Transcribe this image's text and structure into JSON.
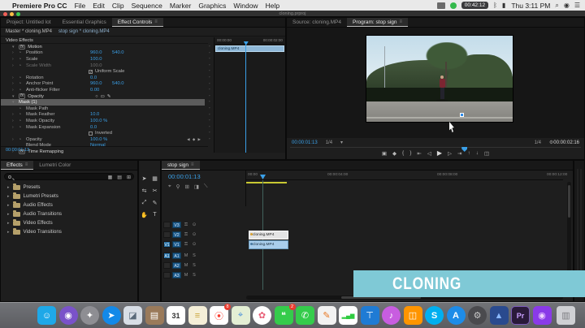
{
  "colors": {
    "accent_blue": "#3aa0e8",
    "value_blue": "#3aa0e8",
    "banner_teal": "#7fc9d6",
    "clip_blue": "#a9cdeb",
    "clip_selected": "#e4e4e4",
    "render_bar_yellow": "#c8c832",
    "menubar_bg": "#e9e9e9",
    "panel_bg": "#1e1e1e"
  },
  "menubar": {
    "app_name": "Premiere Pro CC",
    "menus": [
      "File",
      "Edit",
      "Clip",
      "Sequence",
      "Marker",
      "Graphics",
      "Window",
      "Help"
    ],
    "timer_badge": "00:42:12",
    "clock": "Thu 3:11 PM"
  },
  "window_title": "cloning.prproj",
  "effect_controls": {
    "tabs": [
      {
        "label": "Project: Untitled lot"
      },
      {
        "label": "Essential Graphics"
      },
      {
        "label": "Effect Controls"
      }
    ],
    "breadcrumb": {
      "master": "Master * cloning.MP4",
      "clip": "stop sign * cloning.MP4"
    },
    "section_video_effects": "Video Effects",
    "rows": [
      {
        "label": "Motion"
      },
      {
        "label": "Position",
        "value": "960.0",
        "value2": "540.0"
      },
      {
        "label": "Scale",
        "value": "100.0"
      },
      {
        "label": "Scale Width",
        "value": "100.0"
      },
      {
        "label": "Uniform Scale",
        "check": "✓"
      },
      {
        "label": "Rotation",
        "value": "0.0"
      },
      {
        "label": "Anchor Point",
        "value": "960.0",
        "value2": "540.0"
      },
      {
        "label": "Anti-flicker Filter",
        "value": "0.00"
      },
      {
        "label": "Opacity"
      },
      {
        "label": "Mask (1)"
      },
      {
        "label": "Mask Path"
      },
      {
        "label": "Mask Feather",
        "value": "10.0"
      },
      {
        "label": "Mask Opacity",
        "value": "100.0 %"
      },
      {
        "label": "Mask Expansion",
        "value": "0.0"
      },
      {
        "label": "Inverted",
        "check": ""
      },
      {
        "label": "Opacity",
        "value": "100.0 %"
      },
      {
        "label": "Blend Mode",
        "value": "Normal"
      },
      {
        "label": "Time Remapping"
      }
    ],
    "timecode": "00:00:01:13",
    "mini_timeline": {
      "tick_left": "00:00:00",
      "tick_right": "00:00:02:00",
      "clip_label": "cloning.MP4"
    }
  },
  "program": {
    "tabs": [
      {
        "label": "Source: cloning.MP4"
      },
      {
        "label": "Program: stop sign"
      }
    ],
    "tc_current": "00:00:01:13",
    "zoom_level": "1/4",
    "playback_res": "1/4",
    "tc_duration": "00:00:02:16",
    "transport": [
      "▣",
      "◆",
      "{",
      "}",
      "⇤",
      "◁",
      "▶",
      "▷",
      "⇥",
      "↑",
      "↓",
      "◫"
    ]
  },
  "effects_panel": {
    "tabs": [
      {
        "label": "Effects"
      },
      {
        "label": "Lumetri Color"
      }
    ],
    "bin_icons": [
      "▦",
      "▤",
      "⊞"
    ],
    "folders": [
      "Presets",
      "Lumetri Presets",
      "Audio Effects",
      "Audio Transitions",
      "Video Effects",
      "Video Transitions"
    ]
  },
  "tools": [
    {
      "name": "selection-tool",
      "glyph": "➤"
    },
    {
      "name": "track-select-tool",
      "glyph": "▦"
    },
    {
      "name": "ripple-edit-tool",
      "glyph": "⇆"
    },
    {
      "name": "razor-tool",
      "glyph": "✂"
    },
    {
      "name": "slip-tool",
      "glyph": "⤢"
    },
    {
      "name": "pen-tool",
      "glyph": "✎"
    },
    {
      "name": "hand-tool",
      "glyph": "✋"
    },
    {
      "name": "type-tool",
      "glyph": "T"
    }
  ],
  "timeline": {
    "tab": "stop sign",
    "timecode": "00:00:01:13",
    "toolbar_icons": [
      "⌖",
      "⚲",
      "⊞",
      "◨",
      "⟍"
    ],
    "ruler_ticks": [
      "00:00",
      "00:00:04:00",
      "00:00:08:00",
      "00:00:12:00"
    ],
    "video_tracks": [
      "V3",
      "V2",
      "V1"
    ],
    "audio_tracks": [
      "A1",
      "A2",
      "A3"
    ],
    "clip_top": "cloning.MP4",
    "clip_bottom": "cloning.MP4"
  },
  "banner": {
    "text": "CLONING"
  },
  "dock": {
    "items": [
      {
        "name": "finder",
        "glyph": "☺",
        "bg": "#1ea8e8"
      },
      {
        "name": "siri",
        "glyph": "◉",
        "bg": "#7a52c9",
        "round": true
      },
      {
        "name": "launchpad",
        "glyph": "✦",
        "bg": "#8e8e93",
        "round": true
      },
      {
        "name": "safari",
        "glyph": "➤",
        "bg": "#1389e8",
        "round": true
      },
      {
        "name": "preview",
        "glyph": "◪",
        "bg": "#d8dee6",
        "fg": "#5a6a7a"
      },
      {
        "name": "contacts",
        "glyph": "▤",
        "bg": "#9a7a5a"
      },
      {
        "name": "calendar",
        "glyph": "31",
        "bg": "#ffffff",
        "fg": "#333333"
      },
      {
        "name": "notes",
        "glyph": "≡",
        "bg": "#f5efd8",
        "fg": "#caa53d"
      },
      {
        "name": "reminders",
        "glyph": "⦿",
        "bg": "#ffffff",
        "fg": "#fa3b30",
        "badge": "8"
      },
      {
        "name": "maps",
        "glyph": "⌖",
        "bg": "#e4efd4",
        "fg": "#4a90d9"
      },
      {
        "name": "photos",
        "glyph": "✿",
        "bg": "#ffffff",
        "fg": "#e85d75",
        "round": true
      },
      {
        "name": "messages",
        "glyph": "❝",
        "bg": "#35cc4b",
        "badge": "2"
      },
      {
        "name": "facetime",
        "glyph": "✆",
        "bg": "#35cc4b"
      },
      {
        "name": "pages",
        "glyph": "✎",
        "bg": "#f2f2f2",
        "fg": "#e87722"
      },
      {
        "name": "stocks",
        "glyph": "▂▄▆",
        "bg": "#ffffff",
        "fg": "#2ecc40"
      },
      {
        "name": "keynote",
        "glyph": "⊤",
        "bg": "#1f7bd4"
      },
      {
        "name": "music",
        "glyph": "♪",
        "bg": "#c85de0",
        "round": true
      },
      {
        "name": "books",
        "glyph": "◫",
        "bg": "#ff9500"
      },
      {
        "name": "skype",
        "glyph": "S",
        "bg": "#00aff0",
        "round": true
      },
      {
        "name": "app-store",
        "glyph": "A",
        "bg": "#1e8ce8",
        "round": true
      },
      {
        "name": "system-preferences",
        "glyph": "⚙",
        "bg": "#4a4a4e",
        "fg": "#c8c8c8",
        "round": true
      },
      {
        "name": "blue-peaks-app",
        "glyph": "▲",
        "bg": "#2a4a8e",
        "fg": "#8ab8ff"
      },
      {
        "name": "premiere-pro",
        "glyph": "Pr",
        "bg": "#2a1a3a",
        "fg": "#c9a0ff"
      },
      {
        "name": "photo-booth",
        "glyph": "◉",
        "bg": "#8a3ae8",
        "fg": "#f0d0ff"
      }
    ],
    "trash": {
      "name": "trash",
      "glyph": "▥"
    }
  }
}
